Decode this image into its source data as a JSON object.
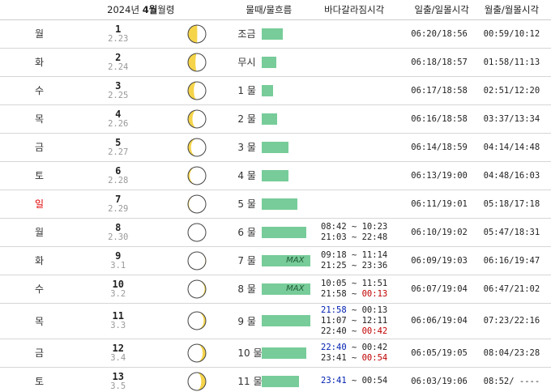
{
  "header": {
    "year_month_prefix": "2024년",
    "month": "4월",
    "moon_phase": "월령",
    "tide_flow": "물때/물흐름",
    "sea_split": "바다갈라짐시각",
    "sunrise_sunset": "일출/일몰시각",
    "moonrise_moonset": "월출/월몰시각"
  },
  "colors": {
    "tide_bar": "#77cc99",
    "sunday": "#e00000",
    "time_blue": "#0020b0",
    "time_red": "#c00000"
  },
  "rows": [
    {
      "weekday": "월",
      "date": "1",
      "lunar": "2.23",
      "phase": "last-quarter",
      "illum": 0.52,
      "tide": "조금",
      "level": 0.3,
      "max": "",
      "times": [],
      "sun": "06:20/18:56",
      "moon": "00:59/10:12"
    },
    {
      "weekday": "화",
      "date": "2",
      "lunar": "2.24",
      "phase": "waning",
      "illum": 0.42,
      "tide": "무시",
      "level": 0.2,
      "max": "",
      "times": [],
      "sun": "06:18/18:57",
      "moon": "01:58/11:13"
    },
    {
      "weekday": "수",
      "date": "3",
      "lunar": "2.25",
      "phase": "waning",
      "illum": 0.33,
      "tide": "1 물",
      "level": 0.16,
      "max": "",
      "times": [],
      "sun": "06:17/18:58",
      "moon": "02:51/12:20"
    },
    {
      "weekday": "목",
      "date": "4",
      "lunar": "2.26",
      "phase": "waning",
      "illum": 0.25,
      "tide": "2 물",
      "level": 0.22,
      "max": "",
      "times": [],
      "sun": "06:16/18:58",
      "moon": "03:37/13:34"
    },
    {
      "weekday": "금",
      "date": "5",
      "lunar": "2.27",
      "phase": "waning",
      "illum": 0.17,
      "tide": "3 물",
      "level": 0.38,
      "max": "",
      "times": [],
      "sun": "06:14/18:59",
      "moon": "04:14/14:48"
    },
    {
      "weekday": "토",
      "date": "6",
      "lunar": "2.28",
      "phase": "waning",
      "illum": 0.1,
      "tide": "4 물",
      "level": 0.38,
      "max": "",
      "times": [],
      "sun": "06:13/19:00",
      "moon": "04:48/16:03"
    },
    {
      "weekday": "일",
      "date": "7",
      "lunar": "2.29",
      "phase": "waning",
      "illum": 0.05,
      "tide": "5 물",
      "level": 0.5,
      "max": "",
      "times": [],
      "sun": "06:11/19:01",
      "moon": "05:18/17:18",
      "sunday": true
    },
    {
      "weekday": "월",
      "date": "8",
      "lunar": "2.30",
      "phase": "new",
      "illum": 0.0,
      "tide": "6 물",
      "level": 0.62,
      "max": "",
      "times": [
        [
          [
            "08:42",
            ""
          ],
          [
            "10:23",
            ""
          ]
        ],
        [
          [
            "21:03",
            ""
          ],
          [
            "22:48",
            ""
          ]
        ]
      ],
      "sun": "06:10/19:02",
      "moon": "05:47/18:31"
    },
    {
      "weekday": "화",
      "date": "9",
      "lunar": "3.1",
      "phase": "waxing",
      "illum": 0.03,
      "tide": "7 물",
      "level": 0.68,
      "max": "MAX",
      "times": [
        [
          [
            "09:18",
            ""
          ],
          [
            "11:14",
            ""
          ]
        ],
        [
          [
            "21:25",
            ""
          ],
          [
            "23:36",
            ""
          ]
        ]
      ],
      "sun": "06:09/19:03",
      "moon": "06:16/19:47"
    },
    {
      "weekday": "수",
      "date": "10",
      "lunar": "3.2",
      "phase": "waxing",
      "illum": 0.07,
      "tide": "8 물",
      "level": 0.68,
      "max": "MAX",
      "times": [
        [
          [
            "10:05",
            ""
          ],
          [
            "11:51",
            ""
          ]
        ],
        [
          [
            "21:58",
            ""
          ],
          [
            "00:13",
            "rd"
          ]
        ]
      ],
      "sun": "06:07/19:04",
      "moon": "06:47/21:02"
    },
    {
      "weekday": "목",
      "date": "11",
      "lunar": "3.3",
      "phase": "waxing",
      "illum": 0.12,
      "tide": "9 물",
      "level": 0.68,
      "max": "",
      "times": [
        [
          [
            "21:58",
            "bl"
          ],
          [
            "00:13",
            ""
          ]
        ],
        [
          [
            "11:07",
            ""
          ],
          [
            "12:11",
            ""
          ]
        ],
        [
          [
            "22:40",
            ""
          ],
          [
            "00:42",
            "rd"
          ]
        ]
      ],
      "sun": "06:06/19:04",
      "moon": "07:23/22:16"
    },
    {
      "weekday": "금",
      "date": "12",
      "lunar": "3.4",
      "phase": "waxing",
      "illum": 0.18,
      "tide": "10 물",
      "level": 0.62,
      "max": "",
      "times": [
        [
          [
            "22:40",
            "bl"
          ],
          [
            "00:42",
            ""
          ]
        ],
        [
          [
            "23:41",
            ""
          ],
          [
            "00:54",
            "rd"
          ]
        ]
      ],
      "sun": "06:05/19:05",
      "moon": "08:04/23:28"
    },
    {
      "weekday": "토",
      "date": "13",
      "lunar": "3.5",
      "phase": "waxing",
      "illum": 0.26,
      "tide": "11 물",
      "level": 0.52,
      "max": "",
      "times": [
        [
          [
            "23:41",
            "bl"
          ],
          [
            "00:54",
            ""
          ]
        ]
      ],
      "sun": "06:03/19:06",
      "moon": "08:52/ ----"
    }
  ]
}
